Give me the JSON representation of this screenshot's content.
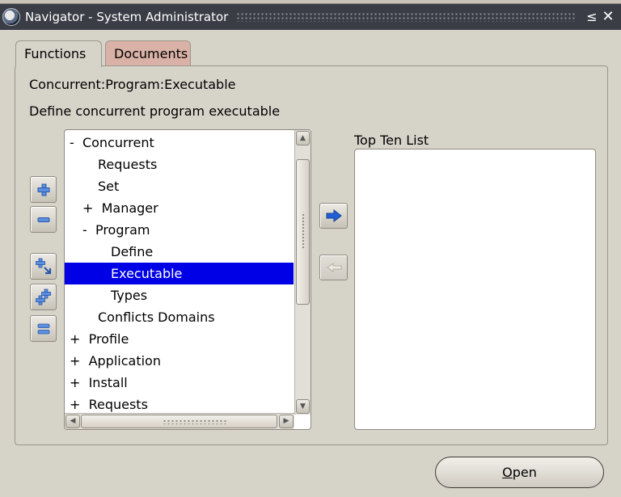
{
  "window": {
    "title": "Navigator - System Administrator",
    "minimize_glyph": "≤",
    "close_glyph": "✕"
  },
  "tabs": [
    {
      "label": "Functions",
      "active": true
    },
    {
      "label": "Documents",
      "active": false
    }
  ],
  "function": {
    "name": "Concurrent:Program:Executable",
    "description": "Define concurrent program executable"
  },
  "side_buttons": [
    {
      "icon": "plus-icon",
      "action": "Expand"
    },
    {
      "icon": "minus-icon",
      "action": "Collapse"
    },
    {
      "icon": "expand-branch-icon",
      "action": "Expand Branch"
    },
    {
      "icon": "expand-all-icon",
      "action": "Expand All"
    },
    {
      "icon": "collapse-all-icon",
      "action": "Collapse All"
    }
  ],
  "tree": {
    "items": [
      {
        "text": "-  Concurrent",
        "level": 0,
        "selected": false
      },
      {
        "text": "Requests",
        "level": 1,
        "selected": false
      },
      {
        "text": "Set",
        "level": 1,
        "selected": false
      },
      {
        "text": "+  Manager",
        "level": 0.5,
        "selected": false
      },
      {
        "text": "-  Program",
        "level": 0.5,
        "selected": false
      },
      {
        "text": "Define",
        "level": 2,
        "selected": false
      },
      {
        "text": "Executable",
        "level": 2,
        "selected": true
      },
      {
        "text": "Types",
        "level": 2,
        "selected": false
      },
      {
        "text": "Conflicts Domains",
        "level": 1,
        "selected": false
      },
      {
        "text": "+  Profile",
        "level": 0,
        "selected": false
      },
      {
        "text": "+  Application",
        "level": 0,
        "selected": false
      },
      {
        "text": "+  Install",
        "level": 0,
        "selected": false
      },
      {
        "text": "+  Requests",
        "level": 0,
        "selected": false
      }
    ]
  },
  "transfer_buttons": {
    "add_icon": "arrow-right-icon",
    "remove_icon": "arrow-left-icon"
  },
  "top_ten": {
    "label": "Top Ten List",
    "items": []
  },
  "open_button": {
    "mnemonic": "O",
    "rest": "pen"
  },
  "colors": {
    "selection": "#0000e6",
    "titlebar": "#3a3d46",
    "documents_tab": "#d9b1a6",
    "arrow_blue": "#1f5fd6"
  }
}
